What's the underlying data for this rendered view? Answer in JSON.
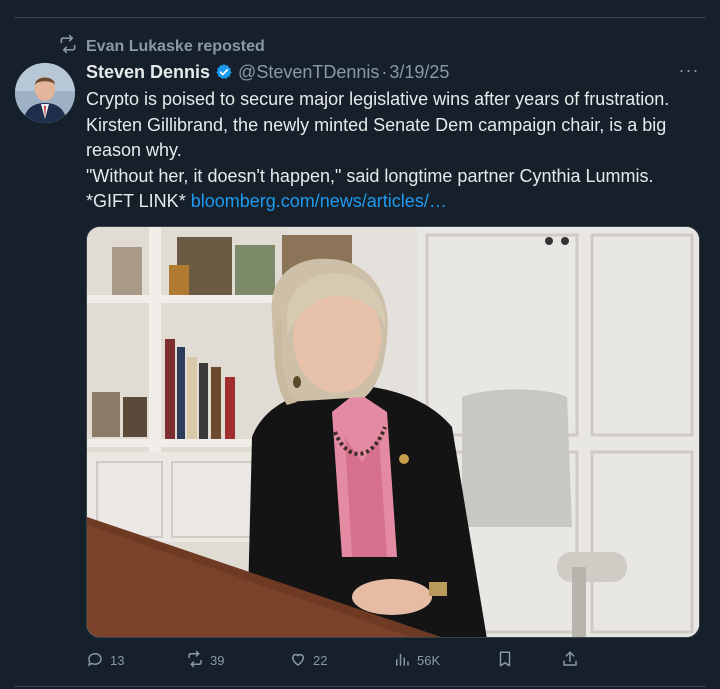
{
  "repost": {
    "text": "Evan Lukaske reposted",
    "icon": "repost-icon"
  },
  "author": {
    "name": "Steven Dennis",
    "handle": "@StevenTDennis",
    "separator": "·",
    "date": "3/19/25",
    "verified_color": "#1d9bf0"
  },
  "more_label": "···",
  "tweet": {
    "line1": "Crypto is poised to secure major legislative wins after years of frustration. Kirsten Gillibrand, the newly minted Senate Dem campaign chair, is a big reason why.",
    "line2": "\"Without her, it doesn't happen,\" said longtime partner Cynthia Lummis.",
    "gift_prefix": "*GIFT LINK*",
    "link_text": "bloomberg.com/news/articles/…"
  },
  "actions": {
    "replies": "13",
    "reposts": "39",
    "likes": "22",
    "views": "56K"
  },
  "colors": {
    "background": "#15202b",
    "muted": "#8b98a5",
    "link": "#1d9bf0"
  }
}
